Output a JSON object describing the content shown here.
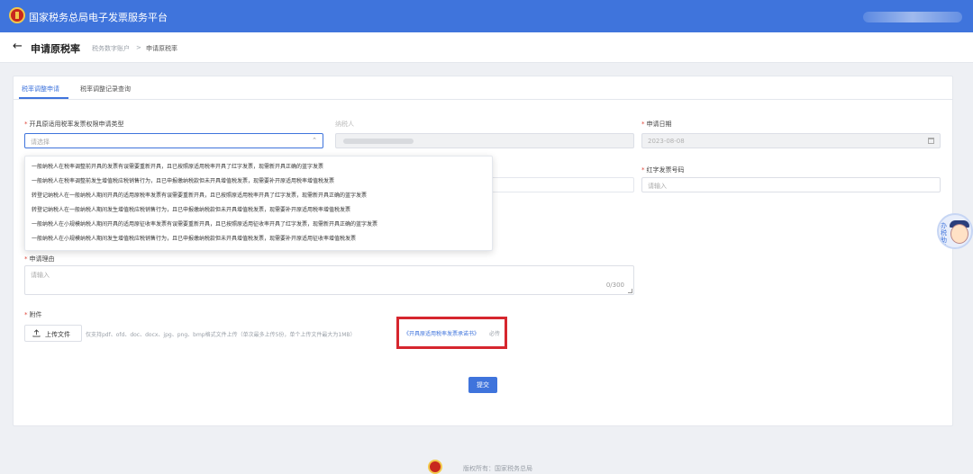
{
  "header": {
    "site_title": "国家税务总局电子发票服务平台",
    "logo_icon": "tax-bureau-emblem"
  },
  "subheader": {
    "back_icon": "arrow-left-icon",
    "page_title": "申请原税率",
    "breadcrumb": [
      "税务数字账户",
      ">",
      "申请原税率"
    ]
  },
  "tabs": [
    {
      "label": "税率调整申请",
      "active": true
    },
    {
      "label": "税率调整记录查询",
      "active": false
    }
  ],
  "form": {
    "type_label": "开具原适用税率发票权限申请类型",
    "type_placeholder": "请选择",
    "taxpayer_label": "纳税人",
    "apply_date_label": "申请日期",
    "apply_date_value": "2023-08-08",
    "red_invoice_label": "红字发票号码",
    "red_invoice_placeholder": "请输入",
    "reason_label": "申请理由",
    "reason_placeholder": "请输入",
    "reason_counter": "0/300",
    "attachment_label": "附件",
    "upload_label": "上传文件",
    "upload_hint": "仅支持pdf、ofd、doc、docx、jpg、png、bmp格式文件上传（单次最多上传5份，单个上传文件最大为1MB）",
    "template_link": "《开具原适用税率发票承诺书》",
    "required_note": "必传",
    "submit_label": "提交"
  },
  "dropdown_options": [
    "一般纳税人在税率调整前开具的发票有误需要重新开具，且已按照原适用税率开具了红字发票，现需新开具正确的蓝字发票",
    "一般纳税人在税率调整前发生增值税应税销售行为，且已申报缴纳税款但未开具增值税发票，现需要补开原适用税率增值税发票",
    "转登记纳税人在一般纳税人期间开具的适用原税率发票有误需要重新开具，且已按照原适用税率开具了红字发票，现需新开具正确的蓝字发票",
    "转登记纳税人在一般纳税人期间发生增值税应税销售行为，且已申报缴纳税款但未开具增值税发票，现需要补开原适用税率增值税发票",
    "一般纳税人在小规模纳税人期间开具的适用原征收率发票有误需要重新开具，且已按照原适用征收率开具了红字发票，现需新开具正确的蓝字发票",
    "一般纳税人在小规模纳税人期间发生增值税应税销售行为，且已申报缴纳税款但未开具增值税发票，现需要补开原适用征收率增值税发票"
  ],
  "floating_assistant": {
    "icon": "assistant-avatar-icon",
    "text": "办税助手"
  },
  "footer": {
    "text": "版权所有：国家税务总局"
  },
  "colors": {
    "primary": "#3f74dc",
    "highlight": "#d6262e",
    "required": "#e0473c"
  }
}
